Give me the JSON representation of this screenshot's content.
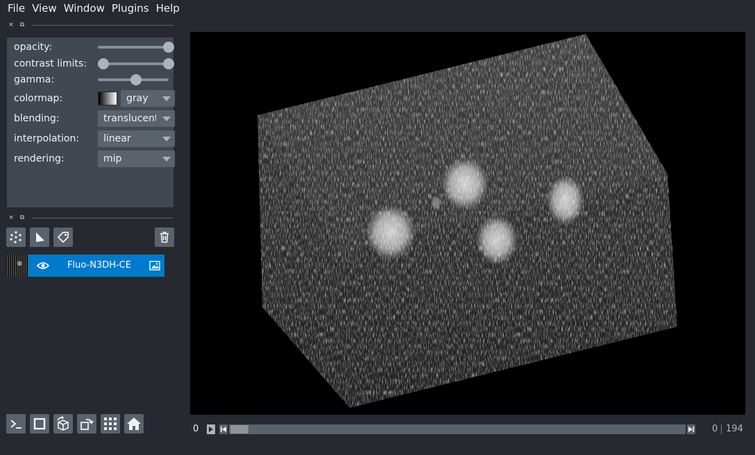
{
  "menu": [
    "File",
    "View",
    "Window",
    "Plugins",
    "Help"
  ],
  "dock": {
    "close_glyph": "×",
    "float_glyph": "⧉"
  },
  "layer_controls": {
    "opacity_label": "opacity:",
    "contrast_label": "contrast limits:",
    "gamma_label": "gamma:",
    "colormap_label": "colormap:",
    "colormap_value": "gray",
    "blending_label": "blending:",
    "blending_value": "translucent",
    "interpolation_label": "interpolation:",
    "interpolation_value": "linear",
    "rendering_label": "rendering:",
    "rendering_value": "mip",
    "opacity": 1.0,
    "contrast_limits": [
      0.0,
      1.0
    ],
    "gamma": 0.5
  },
  "layer_list": {
    "tools": [
      "points-icon",
      "shapes-icon",
      "labels-icon",
      "delete-icon"
    ],
    "layers": [
      {
        "name": "Fluo-N3DH-CE",
        "visible": true,
        "type-icon": "image-icon"
      }
    ]
  },
  "viewer_buttons": [
    "console-icon",
    "ndisplay-icon",
    "roll-icon",
    "transpose-icon",
    "grid-icon",
    "home-icon"
  ],
  "dims": {
    "value": "0",
    "current": "0",
    "total": "194"
  },
  "colors": {
    "background": "#262930",
    "panel": "#414851",
    "accent": "#007acc",
    "button": "#5a626c"
  }
}
